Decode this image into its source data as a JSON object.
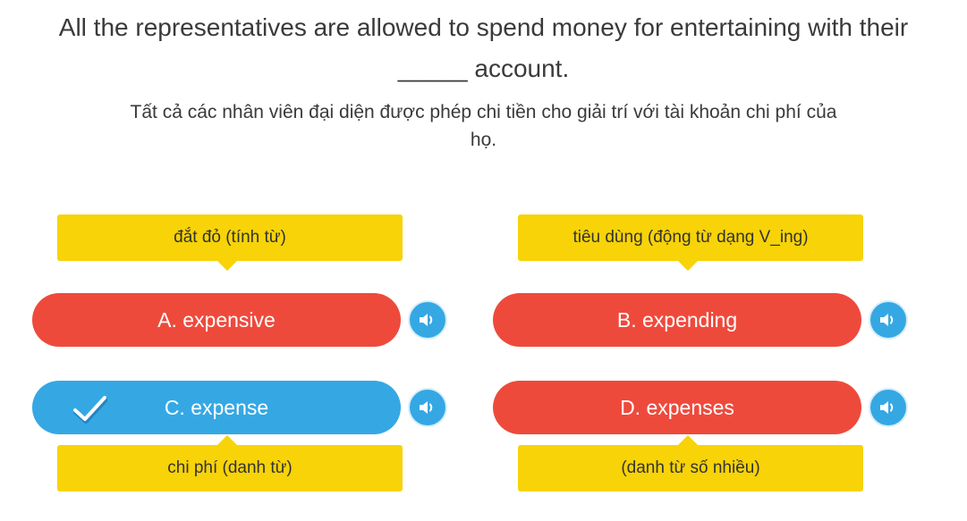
{
  "question": {
    "line1": "All the representatives are allowed to spend money for entertaining with their",
    "line2": "_____ account."
  },
  "translation": {
    "line1": "Tất cả các nhân viên đại diện được phép chi tiền cho giải trí với tài khoản chi phí của",
    "line2": "họ."
  },
  "options": [
    {
      "label": "A. expensive",
      "hint": "đắt đỏ (tính từ)",
      "state": "incorrect",
      "color": "#ee4a3c"
    },
    {
      "label": "B. expending",
      "hint": "tiêu dùng (động từ dạng V_ing)",
      "state": "incorrect",
      "color": "#ee4a3c"
    },
    {
      "label": "C. expense",
      "hint": "chi phí (danh từ)",
      "state": "correct",
      "color": "#35a8e4"
    },
    {
      "label": "D. expenses",
      "hint": "(danh từ số nhiều)",
      "state": "incorrect",
      "color": "#ee4a3c"
    }
  ],
  "icons": {
    "audio": "speaker-icon",
    "correct": "checkmark-icon"
  },
  "colors": {
    "hint_bg": "#f7d308",
    "wrong": "#ee4a3c",
    "right": "#35a8e4"
  }
}
